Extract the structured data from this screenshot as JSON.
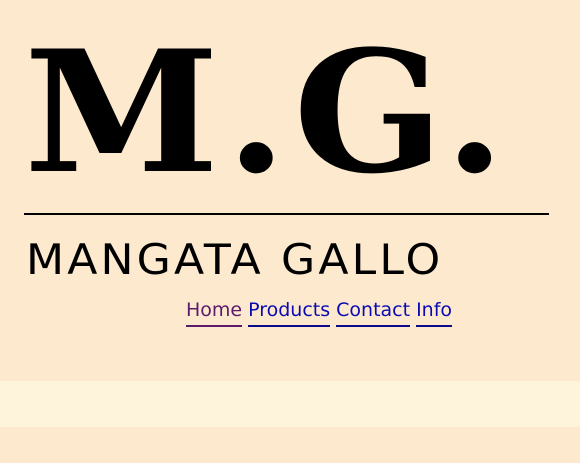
{
  "logo": {
    "monogram": "M.G.",
    "wordmark": "MANGATA GALLO"
  },
  "nav": {
    "items": [
      {
        "label": "Home"
      },
      {
        "label": "Products"
      },
      {
        "label": "Contact"
      },
      {
        "label": "Info"
      }
    ]
  },
  "colors": {
    "background": "#fde9cd",
    "band": "#fef4dc",
    "link": "#0a0ab4",
    "visited_link": "#5b1a6e",
    "logo": "#000000"
  }
}
